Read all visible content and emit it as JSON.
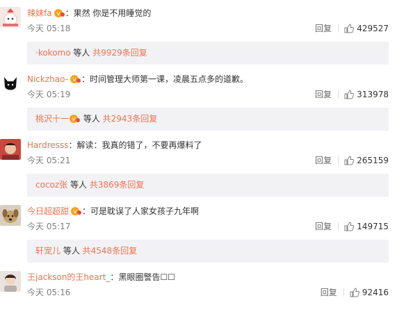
{
  "comments": [
    {
      "username": "辣妹fa",
      "badge": true,
      "text": "果然 你是不用睡觉的",
      "time": "今天 05:18",
      "reply": "回复",
      "likes": "429527",
      "sub": {
        "who": "·kokomo",
        "crown": false,
        "mid": " 等人 ",
        "count": "共9929条回复"
      }
    },
    {
      "username": "Nickzhao-",
      "badge": true,
      "text": "时间管理大师第一课，凌晨五点多的道歉。",
      "time": "今天 05:19",
      "reply": "回复",
      "likes": "313978",
      "sub": {
        "who": "桃沢十一",
        "crown": true,
        "mid": " 等人 ",
        "count": "共2943条回复"
      }
    },
    {
      "username": "Hardresss",
      "badge": false,
      "text": "解读：我真的错了，不要再爆料了",
      "time": "今天 05:21",
      "reply": "回复",
      "likes": "265159",
      "sub": {
        "who": "cocoz张",
        "crown": false,
        "mid": " 等人 ",
        "count": "共3869条回复"
      }
    },
    {
      "username": "今日超超甜",
      "badge": true,
      "text": "可是耽误了人家女孩子九年啊",
      "time": "今天 05:17",
      "reply": "回复",
      "likes": "149715",
      "sub": {
        "who": "轩宠儿",
        "crown": false,
        "mid": " 等人 ",
        "count": "共4548条回复"
      }
    },
    {
      "username": "王jackson的王heart_",
      "badge": false,
      "text": "黑眼圈警告☐☐",
      "time": "今天 05:16",
      "reply": "回复",
      "likes": "92416"
    }
  ],
  "colors": {
    "accent": "#eb7350",
    "sub_bg": "#f2f2f5",
    "text": "#333333",
    "muted": "#808080"
  }
}
